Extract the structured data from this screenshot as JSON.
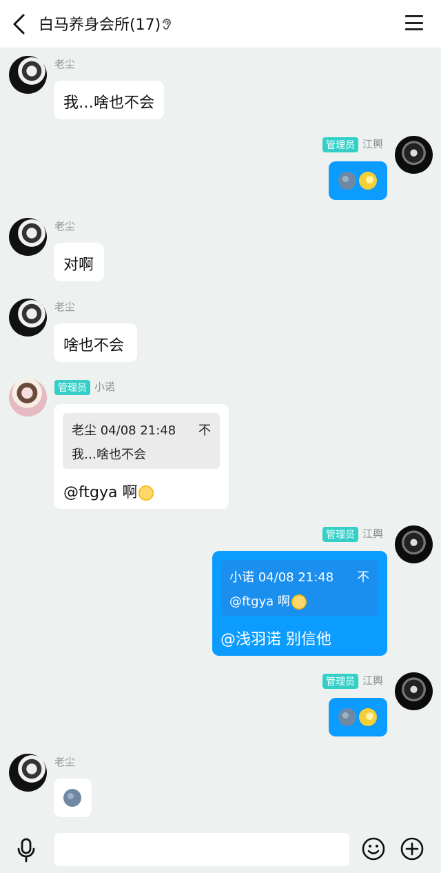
{
  "header": {
    "title": "白马养身会所(17)"
  },
  "messages": [
    {
      "nick": "老尘",
      "text": "我…啥也不会"
    },
    {
      "badge": "管理员",
      "nick": "江輿"
    },
    {
      "nick": "老尘",
      "text": "对啊"
    },
    {
      "nick": "老尘",
      "text": "啥也不会"
    },
    {
      "badge": "管理员",
      "nick": "小诺",
      "quote_header": "老尘 04/08 21:48",
      "quote_body": "我…啥也不会",
      "quote_icon": "不",
      "text": "@ftgya 啊"
    },
    {
      "badge": "管理员",
      "nick": "江輿",
      "quote_header": "小诺 04/08 21:48",
      "quote_body": "@ftgya 啊",
      "quote_icon": "不",
      "text": "@浅羽诺 别信他"
    },
    {
      "badge": "管理员",
      "nick": "江輿"
    },
    {
      "nick": "老尘"
    }
  ],
  "input": {
    "placeholder": ""
  },
  "icons": {
    "back": "chevron-left-icon",
    "ear": "ear-icon",
    "menu": "hamburger-menu-icon",
    "mic": "microphone-icon",
    "emoji": "smiley-icon",
    "plus": "plus-icon"
  },
  "colors": {
    "accent": "#0c9bff",
    "badge": "#35cfc8",
    "background": "#edf1ef"
  }
}
